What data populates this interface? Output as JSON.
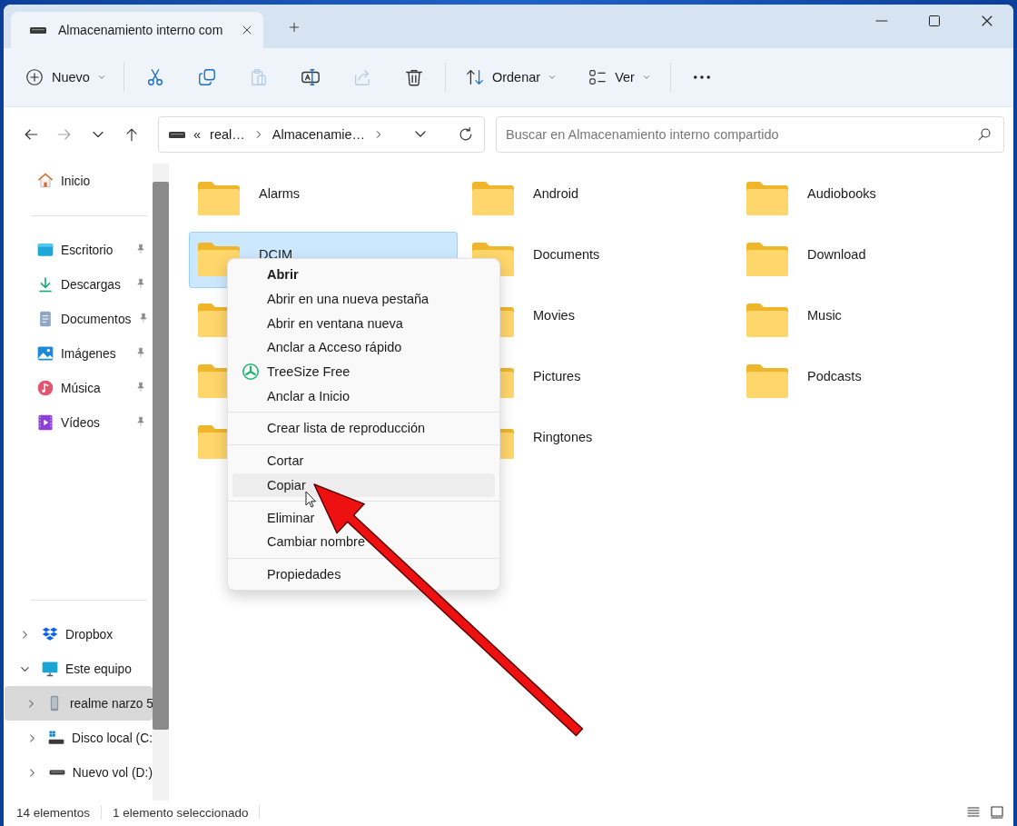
{
  "tab": {
    "title": "Almacenamiento interno com"
  },
  "toolbar": {
    "new_button": {
      "label": "Nuevo"
    },
    "actions": [
      {
        "kind": "cut",
        "disabled": false
      },
      {
        "kind": "copy",
        "disabled": false
      },
      {
        "kind": "paste",
        "disabled": true
      },
      {
        "kind": "rename",
        "disabled": false
      },
      {
        "kind": "share",
        "disabled": true
      },
      {
        "kind": "delete",
        "disabled": false
      }
    ],
    "sort_button": {
      "label": "Ordenar"
    },
    "view_button": {
      "label": "Ver"
    }
  },
  "navigation": [
    {
      "kind": "back",
      "disabled": false
    },
    {
      "kind": "forward",
      "disabled": true
    },
    {
      "kind": "recent",
      "disabled": false
    },
    {
      "kind": "up",
      "disabled": false
    }
  ],
  "address_bar": {
    "overflow": "«",
    "breadcrumbs": [
      "real…",
      "Almacenamie…"
    ]
  },
  "search": {
    "placeholder": "Buscar en Almacenamiento interno compartido"
  },
  "sidebar": {
    "home": {
      "label": "Inicio",
      "kind": "home"
    },
    "pinned": [
      {
        "label": "Escritorio",
        "kind": "desktop",
        "pinned": true
      },
      {
        "label": "Descargas",
        "kind": "download",
        "pinned": true
      },
      {
        "label": "Documentos",
        "kind": "document",
        "pinned": true
      },
      {
        "label": "Imágenes",
        "kind": "image",
        "pinned": true
      },
      {
        "label": "Música",
        "kind": "music",
        "pinned": true
      },
      {
        "label": "Vídeos",
        "kind": "video",
        "pinned": true
      }
    ],
    "tree": [
      {
        "label": "Dropbox",
        "kind": "dropbox",
        "expanded": false,
        "selected": false
      },
      {
        "label": "Este equipo",
        "kind": "pc",
        "expanded": true,
        "selected": false,
        "children": [
          {
            "label": "realme narzo 5",
            "kind": "phone",
            "expanded": false,
            "selected": true
          },
          {
            "label": "Disco local (C:",
            "kind": "system_drive",
            "expanded": false,
            "selected": false
          },
          {
            "label": "Nuevo vol (D:)",
            "kind": "drive",
            "expanded": false,
            "selected": false
          }
        ]
      }
    ]
  },
  "folders": [
    {
      "name": "Alarms",
      "selected": false
    },
    {
      "name": "Android",
      "selected": false
    },
    {
      "name": "Audiobooks",
      "selected": false
    },
    {
      "name": "DCIM",
      "selected": true
    },
    {
      "name": "Documents",
      "selected": false
    },
    {
      "name": "Download",
      "selected": false
    },
    {
      "selected": false
    },
    {
      "name": "Movies",
      "selected": false
    },
    {
      "name": "Music",
      "selected": false
    },
    {
      "selected": false
    },
    {
      "name": "Pictures",
      "selected": false
    },
    {
      "name": "Podcasts",
      "selected": false
    },
    {
      "selected": false
    },
    {
      "name": "Ringtones",
      "selected": false
    }
  ],
  "context_menu": {
    "items": [
      {
        "kind": "item",
        "label": "Abrir",
        "default": true,
        "highlighted": false
      },
      {
        "kind": "item",
        "label": "Abrir en una nueva pestaña",
        "default": false,
        "highlighted": false
      },
      {
        "kind": "item",
        "label": "Abrir en ventana nueva",
        "default": false,
        "highlighted": false
      },
      {
        "kind": "item",
        "label": "Anclar a Acceso rápido",
        "default": false,
        "highlighted": false
      },
      {
        "kind": "app",
        "label": "TreeSize Free",
        "default": false,
        "highlighted": false
      },
      {
        "kind": "item",
        "label": "Anclar a Inicio",
        "default": false,
        "highlighted": false
      },
      {
        "kind": "separator"
      },
      {
        "kind": "item",
        "label": "Crear lista de reproducción",
        "default": false,
        "highlighted": false
      },
      {
        "kind": "separator"
      },
      {
        "kind": "item",
        "label": "Cortar",
        "default": false,
        "highlighted": false
      },
      {
        "kind": "item",
        "label": "Copiar",
        "default": false,
        "highlighted": true
      },
      {
        "kind": "separator"
      },
      {
        "kind": "item",
        "label": "Eliminar",
        "default": false,
        "highlighted": false
      },
      {
        "kind": "item",
        "label": "Cambiar nombre",
        "default": false,
        "highlighted": false
      },
      {
        "kind": "separator"
      },
      {
        "kind": "item",
        "label": "Propiedades",
        "default": false,
        "highlighted": false
      }
    ]
  },
  "status_bar": {
    "item_count": "14 elementos",
    "selection": "1 elemento seleccionado"
  },
  "annotation": {
    "kind": "arrow"
  }
}
